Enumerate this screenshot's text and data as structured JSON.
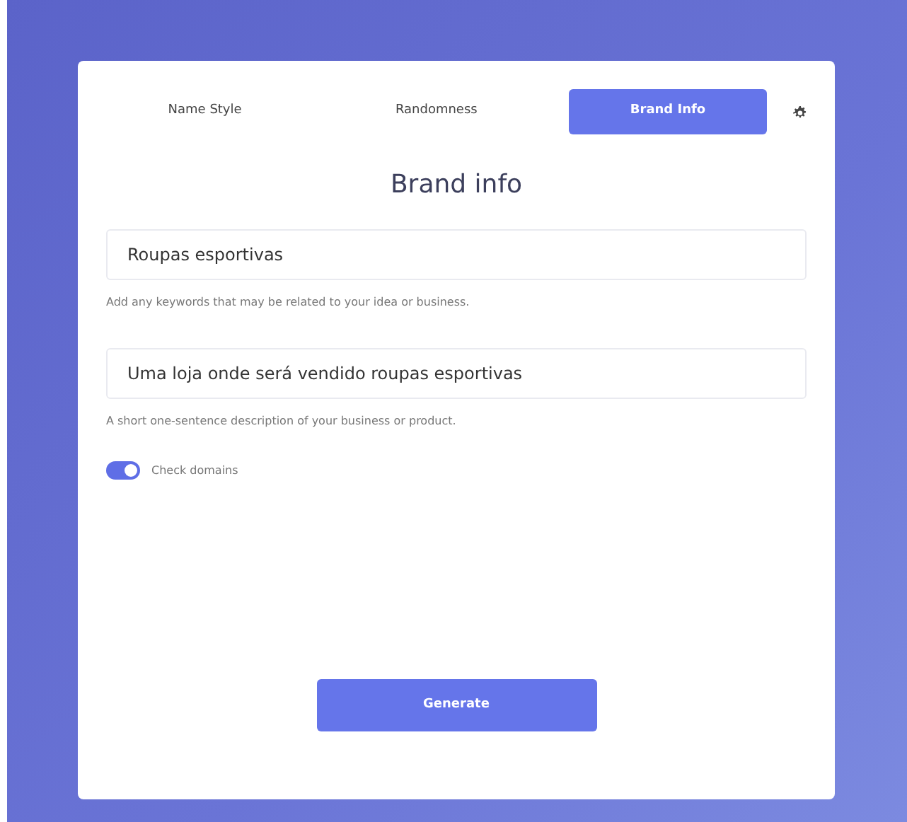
{
  "tabs": [
    {
      "label": "Name Style",
      "selected": false
    },
    {
      "label": "Randomness",
      "selected": false
    },
    {
      "label": "Brand Info",
      "selected": true
    }
  ],
  "title": "Brand info",
  "fields": [
    {
      "value": "Roupas esportivas",
      "help": "Add any keywords that may be related to your idea or business."
    },
    {
      "value": "Uma loja onde será vendido roupas esportivas",
      "help": "A short one-sentence description of your business or product."
    }
  ],
  "check_domains": {
    "label": "Check domains",
    "on": true
  },
  "button": "Generate"
}
